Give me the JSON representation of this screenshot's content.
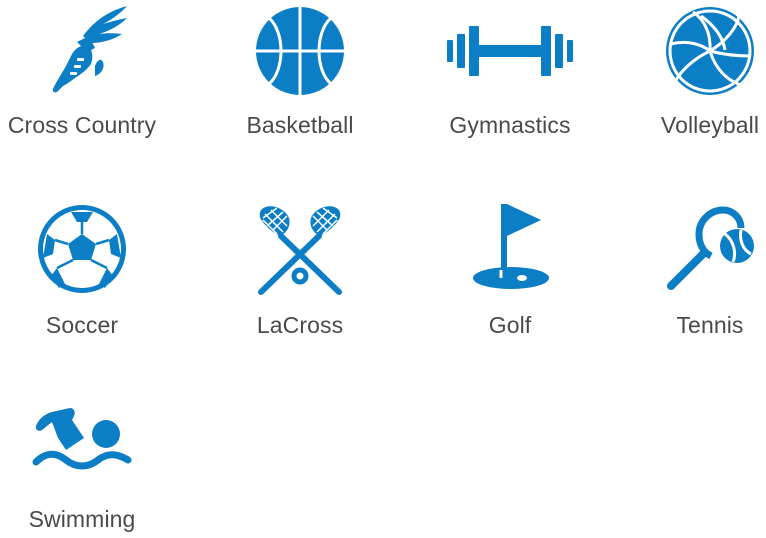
{
  "accent_color": "#0b7ec5",
  "label_color": "#4a4a4a",
  "sports": [
    {
      "label": "Cross Country",
      "icon": "winged-shoe-icon"
    },
    {
      "label": "Basketball",
      "icon": "basketball-icon"
    },
    {
      "label": "Gymnastics",
      "icon": "dumbbell-icon"
    },
    {
      "label": "Volleyball",
      "icon": "volleyball-icon"
    },
    {
      "label": "Soccer",
      "icon": "soccer-ball-icon"
    },
    {
      "label": "LaCross",
      "icon": "lacrosse-sticks-icon"
    },
    {
      "label": "Golf",
      "icon": "golf-flag-icon"
    },
    {
      "label": "Tennis",
      "icon": "tennis-racket-icon"
    },
    {
      "label": "Swimming",
      "icon": "swimmer-icon"
    }
  ]
}
